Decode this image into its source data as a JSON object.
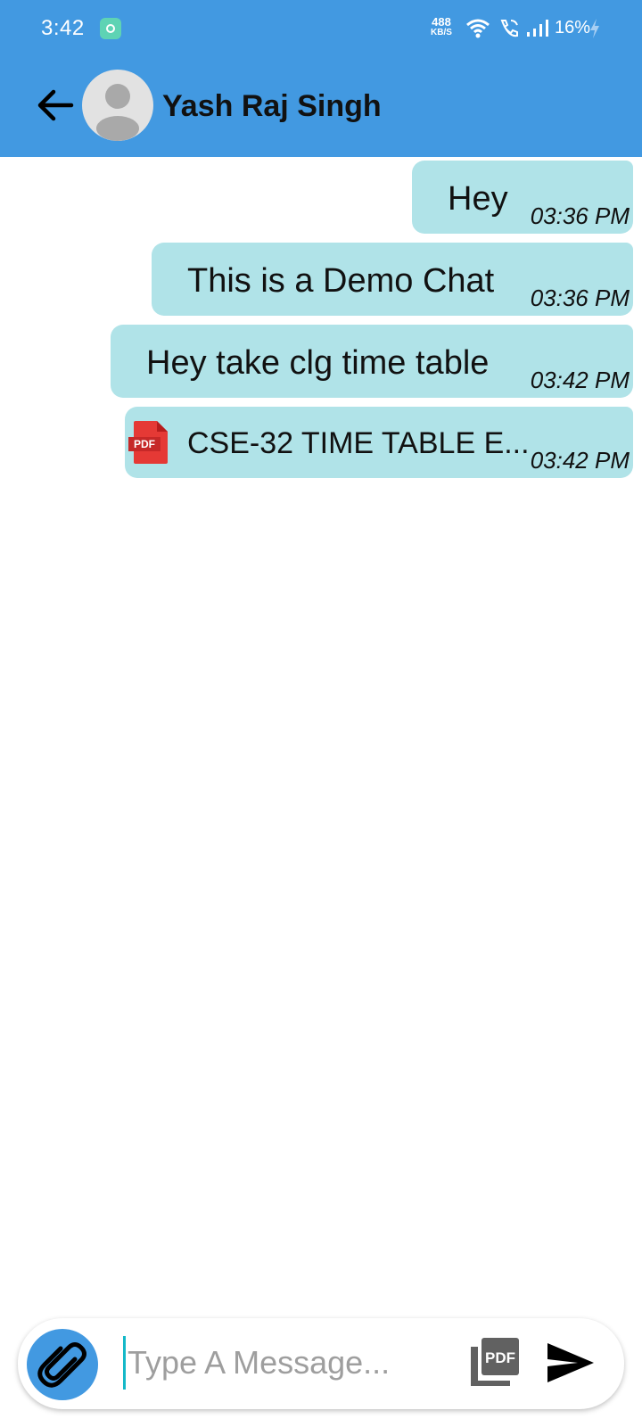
{
  "status_bar": {
    "time": "3:42",
    "net_speed_value": "488",
    "net_speed_unit": "KB/S",
    "battery": "16%",
    "icons": [
      "app-icon",
      "wifi-icon",
      "wifi-call-icon",
      "signal-icon",
      "charging-bolt-icon"
    ]
  },
  "header": {
    "back_icon": "arrow-left-icon",
    "avatar_icon": "person-icon",
    "contact_name": "Yash Raj Singh",
    "background_color": "#4299E1"
  },
  "messages": [
    {
      "type": "text",
      "text": "Hey",
      "time": "03:36 PM"
    },
    {
      "type": "text",
      "text": "This is a Demo Chat",
      "time": "03:36 PM"
    },
    {
      "type": "text",
      "text": "Hey take clg time table",
      "time": "03:42 PM"
    },
    {
      "type": "file",
      "icon": "pdf-file-icon",
      "text": "CSE-32 TIME TABLE E...",
      "time": "03:42 PM"
    }
  ],
  "bubble_color": "#B0E3E8",
  "input_bar": {
    "attach_icon": "paperclip-icon",
    "placeholder": "Type A Message...",
    "value": "",
    "pdf_icon": "pdf-icon",
    "send_icon": "send-icon"
  }
}
